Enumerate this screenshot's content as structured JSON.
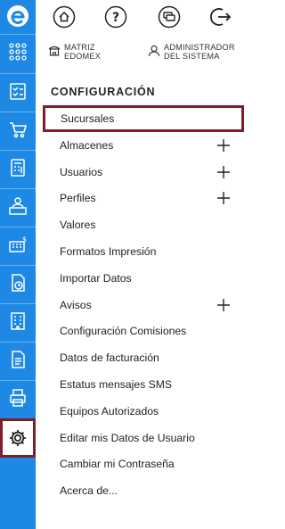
{
  "topbar": {
    "buttons": [
      {
        "icon": "home-icon"
      },
      {
        "icon": "help-icon"
      },
      {
        "icon": "chat-icon"
      },
      {
        "icon": "logout-icon"
      }
    ]
  },
  "user": {
    "branch_line1": "MATRIZ",
    "branch_line2": "EDOMEX",
    "user_line1": "ADMINISTRADOR",
    "user_line2": "DEL SISTEMA"
  },
  "section_title": "CONFIGURACIÓN",
  "menu": [
    {
      "label": "Sucursales",
      "active": true,
      "expandable": false
    },
    {
      "label": "Almacenes",
      "active": false,
      "expandable": true
    },
    {
      "label": "Usuarios",
      "active": false,
      "expandable": true
    },
    {
      "label": "Perfiles",
      "active": false,
      "expandable": true
    },
    {
      "label": "Valores",
      "active": false,
      "expandable": false
    },
    {
      "label": "Formatos Impresión",
      "active": false,
      "expandable": false
    },
    {
      "label": "Importar Datos",
      "active": false,
      "expandable": false
    },
    {
      "label": "Avisos",
      "active": false,
      "expandable": true
    },
    {
      "label": "Configuración Comisiones",
      "active": false,
      "expandable": false
    },
    {
      "label": "Datos de facturación",
      "active": false,
      "expandable": false
    },
    {
      "label": "Estatus mensajes SMS",
      "active": false,
      "expandable": false
    },
    {
      "label": "Equipos Autorizados",
      "active": false,
      "expandable": false
    },
    {
      "label": "Editar mis Datos de Usuario",
      "active": false,
      "expandable": false
    },
    {
      "label": "Cambiar mi Contraseña",
      "active": false,
      "expandable": false
    },
    {
      "label": "Acerca de...",
      "active": false,
      "expandable": false
    }
  ],
  "rail": [
    {
      "icon": "apps-grid-icon"
    },
    {
      "icon": "checklist-icon"
    },
    {
      "icon": "cart-icon"
    },
    {
      "icon": "calculator-icon"
    },
    {
      "icon": "cashier-icon"
    },
    {
      "icon": "cash-register-icon"
    },
    {
      "icon": "document-clock-icon"
    },
    {
      "icon": "building-icon"
    },
    {
      "icon": "document-icon"
    },
    {
      "icon": "printer-icon"
    },
    {
      "icon": "gear-icon",
      "active": true
    }
  ],
  "colors": {
    "brand": "#1e88e5",
    "highlight": "#7b1f2a"
  }
}
